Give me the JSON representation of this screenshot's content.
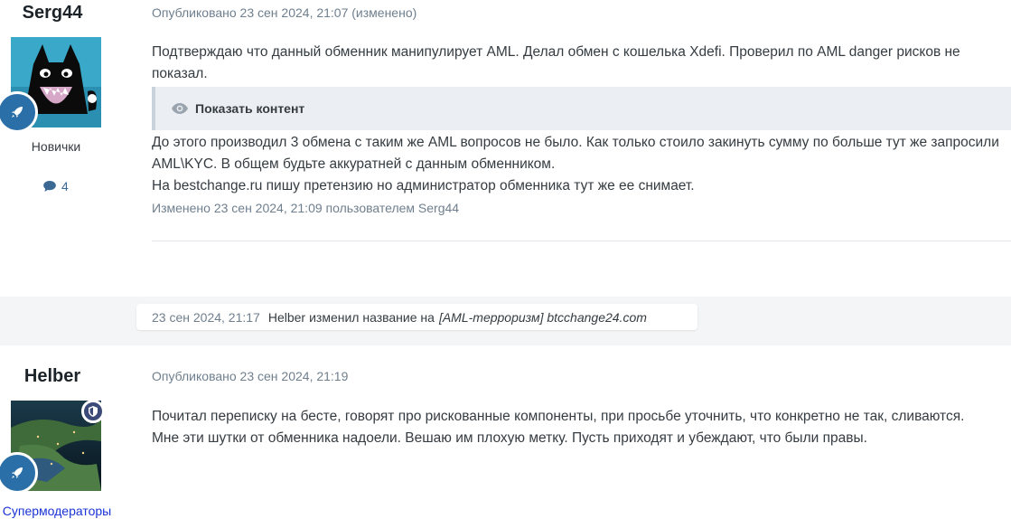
{
  "posts": [
    {
      "author": "Serg44",
      "group": "Новички",
      "post_count": "4",
      "meta": "Опубликовано 23 сен 2024, 21:07 (изменено)",
      "paragraph1": "Подтверждаю что данный обменник манипулирует AML. Делал обмен с кошелька Xdefi. Проверил по AML danger рисков не показал.",
      "spoiler_label": "Показать контент",
      "paragraph2": "До этого производил 3 обмена с таким же AML вопросов не было. Как только стоило закинуть сумму по больше тут же запросили AML\\KYC. В общем будьте аккуратней с данным обменником.",
      "paragraph3": "На bestchange.ru пишу претензию но администратор обменника тут же ее снимает.",
      "edited": "Изменено 23 сен 2024, 21:09 пользователем Serg44"
    },
    {
      "author": "Helber",
      "group": "Супермодераторы",
      "meta": "Опубликовано 23 сен 2024, 21:19",
      "paragraph1": "Почитал переписку на бесте, говорят про рискованные компоненты, при просьбе уточнить, что конкретно не так, сливаются.",
      "paragraph2": "Мне эти шутки от обменника надоели. Вешаю им плохую метку. Пусть приходят и убеждают, что были правы."
    }
  ],
  "event": {
    "time": "23 сен 2024, 21:17",
    "user": "Helber",
    "action": "изменил название на",
    "new_title": "[AML-терроризм] btcchange24.com"
  },
  "colors": {
    "rank_badge": "#2a6fa7",
    "mod_badge": "#3b4a78",
    "moderator_group": "#1a33d6",
    "meta_text": "#6f7f8e"
  },
  "icons": {
    "rank": "rocket-icon",
    "moderator": "shield-icon",
    "comment": "comment-icon",
    "spoiler": "eye-icon"
  }
}
